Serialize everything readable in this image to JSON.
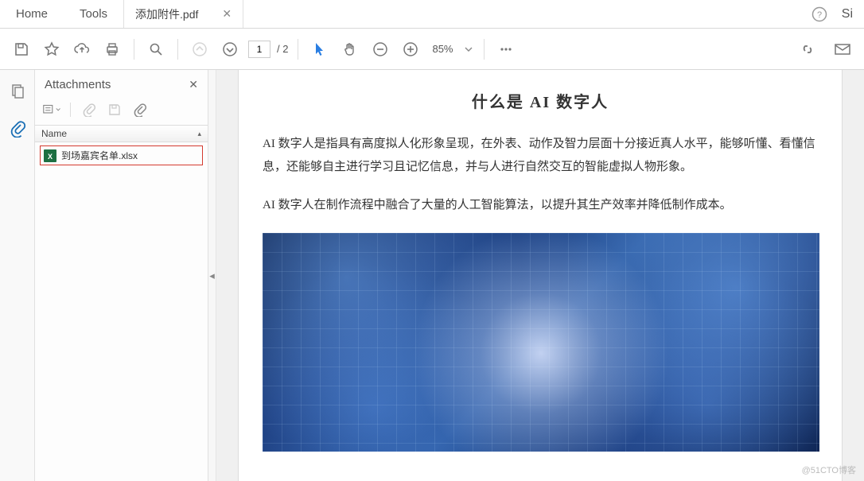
{
  "tabs": {
    "home": "Home",
    "tools": "Tools"
  },
  "file": {
    "name": "添加附件.pdf",
    "signin": "Si"
  },
  "toolbar": {
    "page_current": "1",
    "page_total": "/ 2",
    "zoom": "85%"
  },
  "panel": {
    "title": "Attachments",
    "name_header": "Name",
    "items": [
      {
        "filename": "到场嘉宾名单.xlsx"
      }
    ]
  },
  "doc": {
    "title": "什么是 AI 数字人",
    "p1": "AI 数字人是指具有高度拟人化形象呈现，在外表、动作及智力层面十分接近真人水平，能够听懂、看懂信息，还能够自主进行学习且记忆信息，并与人进行自然交互的智能虚拟人物形象。",
    "p2": "AI 数字人在制作流程中融合了大量的人工智能算法，以提升其生产效率并降低制作成本。"
  },
  "watermark": "@51CTO博客"
}
